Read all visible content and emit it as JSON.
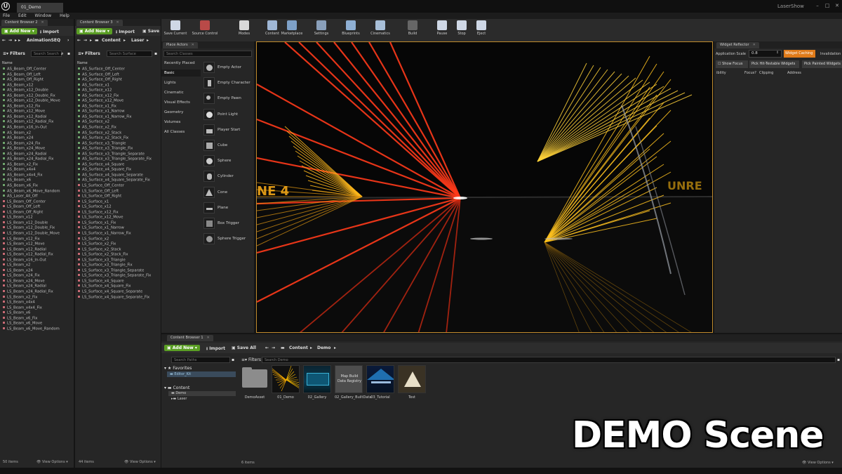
{
  "app": {
    "logo": "U",
    "document_tab": "01_Demo",
    "project": "LaserShow",
    "window_controls": [
      "–",
      "□",
      "✕"
    ]
  },
  "menu": [
    "File",
    "Edit",
    "Window",
    "Help"
  ],
  "content_browser_2": {
    "tab": "Content Browser 2",
    "add_new": "Add New",
    "import": "Import",
    "save": "Save",
    "path": [
      "AnimationSEQ"
    ],
    "filters": "Filters",
    "search_placeholder": "Search Search",
    "col_name": "Name",
    "items": [
      {
        "name": "AS_Beam_Off_Center",
        "color": "green"
      },
      {
        "name": "AS_Beam_Off_Left",
        "color": "green"
      },
      {
        "name": "AS_Beam_Off_Right",
        "color": "green"
      },
      {
        "name": "AS_Beam_x12",
        "color": "green"
      },
      {
        "name": "AS_Beam_x12_Double",
        "color": "green"
      },
      {
        "name": "AS_Beam_x12_Double_Fix",
        "color": "green"
      },
      {
        "name": "AS_Beam_x12_Double_Move",
        "color": "green"
      },
      {
        "name": "AS_Beam_x12_Fix",
        "color": "green"
      },
      {
        "name": "AS_Beam_x12_Move",
        "color": "green"
      },
      {
        "name": "AS_Beam_x12_Radial",
        "color": "green"
      },
      {
        "name": "AS_Beam_x12_Radial_Fix",
        "color": "green"
      },
      {
        "name": "AS_Beam_x16_In-Out",
        "color": "green"
      },
      {
        "name": "AS_Beam_x2",
        "color": "green"
      },
      {
        "name": "AS_Beam_x24",
        "color": "green"
      },
      {
        "name": "AS_Beam_x24_Fix",
        "color": "green"
      },
      {
        "name": "AS_Beam_x24_Move",
        "color": "green"
      },
      {
        "name": "AS_Beam_x24_Radial",
        "color": "green"
      },
      {
        "name": "AS_Beam_x24_Radial_Fix",
        "color": "green"
      },
      {
        "name": "AS_Beam_x2_Fix",
        "color": "green"
      },
      {
        "name": "AS_Beam_x4x4",
        "color": "green"
      },
      {
        "name": "AS_Beam_x4x4_Fix",
        "color": "green"
      },
      {
        "name": "AS_Beam_x6",
        "color": "green"
      },
      {
        "name": "AS_Beam_x6_Fix",
        "color": "green"
      },
      {
        "name": "AS_Beam_x6_Move_Random",
        "color": "green"
      },
      {
        "name": "AS_Laser_All_Off",
        "color": "green"
      },
      {
        "name": "LS_Beam_Off_Center",
        "color": "red"
      },
      {
        "name": "LS_Beam_Off_Left",
        "color": "red"
      },
      {
        "name": "LS_Beam_Off_Right",
        "color": "red"
      },
      {
        "name": "LS_Beam_x12",
        "color": "red"
      },
      {
        "name": "LS_Beam_x12_Double",
        "color": "red"
      },
      {
        "name": "LS_Beam_x12_Double_Fix",
        "color": "red"
      },
      {
        "name": "LS_Beam_x12_Double_Move",
        "color": "red"
      },
      {
        "name": "LS_Beam_x12_Fix",
        "color": "red"
      },
      {
        "name": "LS_Beam_x12_Move",
        "color": "red"
      },
      {
        "name": "LS_Beam_x12_Radial",
        "color": "red"
      },
      {
        "name": "LS_Beam_x12_Radial_Fix",
        "color": "red"
      },
      {
        "name": "LS_Beam_x16_In-Out",
        "color": "red"
      },
      {
        "name": "LS_Beam_x2",
        "color": "red"
      },
      {
        "name": "LS_Beam_x24",
        "color": "red"
      },
      {
        "name": "LS_Beam_x24_Fix",
        "color": "red"
      },
      {
        "name": "LS_Beam_x24_Move",
        "color": "red"
      },
      {
        "name": "LS_Beam_x24_Radial",
        "color": "red"
      },
      {
        "name": "LS_Beam_x24_Radial_Fix",
        "color": "red"
      },
      {
        "name": "LS_Beam_x2_Fix",
        "color": "red"
      },
      {
        "name": "LS_Beam_x4x4",
        "color": "red"
      },
      {
        "name": "LS_Beam_x4x4_Fix",
        "color": "red"
      },
      {
        "name": "LS_Beam_x6",
        "color": "red"
      },
      {
        "name": "LS_Beam_x6_Fix",
        "color": "red"
      },
      {
        "name": "LS_Beam_x6_Move",
        "color": "red"
      },
      {
        "name": "LS_Beam_x6_Move_Random",
        "color": "red"
      }
    ],
    "count": "50 items",
    "view_options": "View Options"
  },
  "content_browser_3": {
    "tab": "Content Browser 3",
    "add_new": "Add New",
    "import": "Import",
    "save": "Save",
    "path": [
      "Content",
      "Laser"
    ],
    "filters": "Filters",
    "search_placeholder": "Search Surface",
    "col_name": "Name",
    "items": [
      {
        "name": "AS_Surface_Off_Center",
        "color": "green"
      },
      {
        "name": "AS_Surface_Off_Left",
        "color": "green"
      },
      {
        "name": "AS_Surface_Off_Right",
        "color": "green"
      },
      {
        "name": "AS_Surface_x1",
        "color": "green"
      },
      {
        "name": "AS_Surface_x12",
        "color": "green"
      },
      {
        "name": "AS_Surface_x12_Fix",
        "color": "green"
      },
      {
        "name": "AS_Surface_x12_Move",
        "color": "green"
      },
      {
        "name": "AS_Surface_x1_Fix",
        "color": "green"
      },
      {
        "name": "AS_Surface_x1_Narrow",
        "color": "green"
      },
      {
        "name": "AS_Surface_x1_Narrow_Fix",
        "color": "green"
      },
      {
        "name": "AS_Surface_x2",
        "color": "green"
      },
      {
        "name": "AS_Surface_x2_Fix",
        "color": "green"
      },
      {
        "name": "AS_Surface_x2_Stack",
        "color": "green"
      },
      {
        "name": "AS_Surface_x2_Stack_Fix",
        "color": "green"
      },
      {
        "name": "AS_Surface_x3_Triangle",
        "color": "green"
      },
      {
        "name": "AS_Surface_x3_Triangle_Fix",
        "color": "green"
      },
      {
        "name": "AS_Surface_x3_Triangle_Separate",
        "color": "green"
      },
      {
        "name": "AS_Surface_x3_Triangle_Separate_Fix",
        "color": "green"
      },
      {
        "name": "AS_Surface_x4_Square",
        "color": "green"
      },
      {
        "name": "AS_Surface_x4_Square_Fix",
        "color": "green"
      },
      {
        "name": "AS_Surface_x4_Square_Separate",
        "color": "green"
      },
      {
        "name": "AS_Surface_x4_Square_Separate_Fix",
        "color": "green"
      },
      {
        "name": "LS_Surface_Off_Center",
        "color": "red"
      },
      {
        "name": "LS_Surface_Off_Left",
        "color": "red"
      },
      {
        "name": "LS_Surface_Off_Right",
        "color": "red"
      },
      {
        "name": "LS_Surface_x1",
        "color": "red"
      },
      {
        "name": "LS_Surface_x12",
        "color": "red"
      },
      {
        "name": "LS_Surface_x12_Fix",
        "color": "red"
      },
      {
        "name": "LS_Surface_x12_Move",
        "color": "red"
      },
      {
        "name": "LS_Surface_x1_Fix",
        "color": "red"
      },
      {
        "name": "LS_Surface_x1_Narrow",
        "color": "red"
      },
      {
        "name": "LS_Surface_x1_Narrow_Fix",
        "color": "red"
      },
      {
        "name": "LS_Surface_x2",
        "color": "red"
      },
      {
        "name": "LS_Surface_x2_Fix",
        "color": "red"
      },
      {
        "name": "LS_Surface_x2_Stack",
        "color": "red"
      },
      {
        "name": "LS_Surface_x2_Stack_Fix",
        "color": "red"
      },
      {
        "name": "LS_Surface_x3_Triangle",
        "color": "red"
      },
      {
        "name": "LS_Surface_x3_Triangle_Fix",
        "color": "red"
      },
      {
        "name": "LS_Surface_x3_Triangle_Separate",
        "color": "red"
      },
      {
        "name": "LS_Surface_x3_Triangle_Separate_Fix",
        "color": "red"
      },
      {
        "name": "LS_Surface_x4_Square",
        "color": "red"
      },
      {
        "name": "LS_Surface_x4_Square_Fix",
        "color": "red"
      },
      {
        "name": "LS_Surface_x4_Square_Separate",
        "color": "red"
      },
      {
        "name": "LS_Surface_x4_Square_Separate_Fix",
        "color": "red"
      }
    ],
    "count": "44 items",
    "view_options": "View Options"
  },
  "main_toolbar": [
    {
      "label": "Save Current",
      "icon": "save-icon",
      "color": "#cfd8e6"
    },
    {
      "label": "Source Control",
      "icon": "source-control-icon",
      "color": "#b94a48"
    },
    {
      "label": "Modes",
      "icon": "modes-icon",
      "color": "#d9d9d9"
    },
    {
      "label": "Content",
      "icon": "content-icon",
      "color": "#9fb7d6"
    },
    {
      "label": "Marketplace",
      "icon": "marketplace-icon",
      "color": "#7ea1c8"
    },
    {
      "label": "Settings",
      "icon": "settings-icon",
      "color": "#8aa0bb"
    },
    {
      "label": "Blueprints",
      "icon": "blueprints-icon",
      "color": "#8fb0d4"
    },
    {
      "label": "Cinematics",
      "icon": "cinematics-icon",
      "color": "#a8bfd8"
    },
    {
      "label": "Build",
      "icon": "build-icon",
      "color": "#666666"
    },
    {
      "label": "Pause",
      "icon": "pause-icon",
      "color": "#cfd8e6"
    },
    {
      "label": "Stop",
      "icon": "stop-icon",
      "color": "#cfd8e6"
    },
    {
      "label": "Eject",
      "icon": "eject-icon",
      "color": "#cfd8e6"
    }
  ],
  "place_actors": {
    "tab": "Place Actors",
    "search_placeholder": "Search Classes",
    "categories": [
      "Recently Placed",
      "Basic",
      "Lights",
      "Cinematic",
      "Visual Effects",
      "Geometry",
      "Volumes",
      "All Classes"
    ],
    "active_category": "Basic",
    "actors": [
      "Empty Actor",
      "Empty Character",
      "Empty Pawn",
      "Point Light",
      "Player Start",
      "Cube",
      "Sphere",
      "Cylinder",
      "Cone",
      "Plane",
      "Box Trigger",
      "Sphere Trigger"
    ]
  },
  "widget_reflector": {
    "tab": "Widget Reflector",
    "scale_label": "Application Scale",
    "scale_value": "0.8",
    "caching_button": "Widget Caching",
    "invalidation": "Invalidation",
    "show_focus": "Show Focus",
    "pick_hit": "Pick Hit-Testable Widgets",
    "pick_painted": "Pick Painted Widgets",
    "columns": [
      "ibility",
      "Focus?",
      "Clipping",
      "Address"
    ]
  },
  "content_browser_1": {
    "tab": "Content Browser 1",
    "add_new": "Add New",
    "import": "Import",
    "save_all": "Save All",
    "path": [
      "Content",
      "Demo"
    ],
    "search_paths_placeholder": "Search Paths",
    "filters": "Filters",
    "search_placeholder": "Search Demo",
    "favorites_label": "Favorites",
    "favorites": [
      "Editor_Kit"
    ],
    "tree_root": "Content",
    "tree_children": [
      "Demo",
      "Laser"
    ],
    "assets": [
      {
        "label": "DemoAsset",
        "kind": "folder"
      },
      {
        "label": "01_Demo",
        "kind": "laser"
      },
      {
        "label": "02_Gallery",
        "kind": "gallery"
      },
      {
        "label": "02_Gallery_BuiltData",
        "kind": "builtdata",
        "overlay": "Map Build Data Registry"
      },
      {
        "label": "03_Tutorial",
        "kind": "tutorial"
      },
      {
        "label": "Test",
        "kind": "test"
      }
    ],
    "count": "6 items",
    "view_options": "View Options"
  },
  "overlay_title": "DEMO Scene",
  "viewport": {
    "overlay_text_left": "NE 4",
    "overlay_text_right": "UNRE"
  }
}
